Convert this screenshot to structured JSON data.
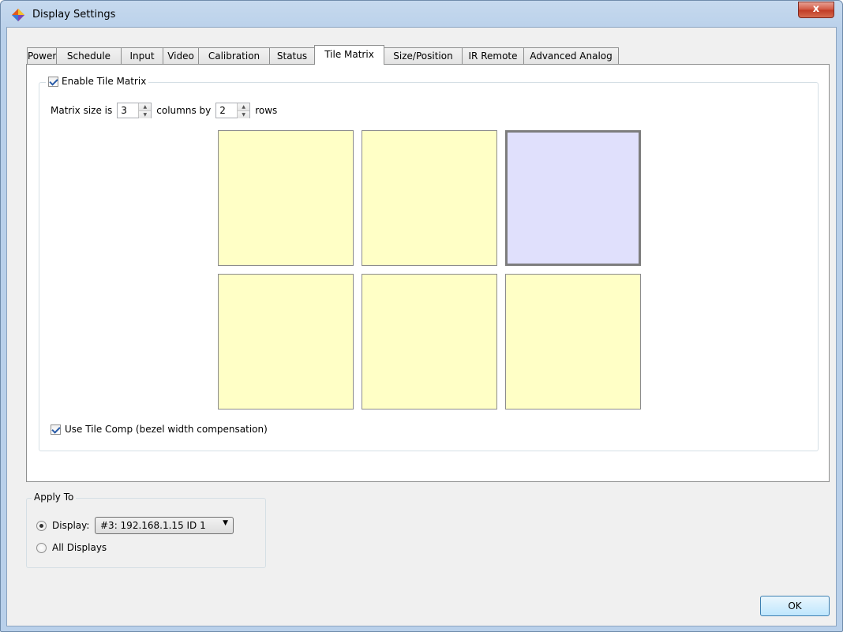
{
  "window": {
    "title": "Display Settings",
    "close_label": "x"
  },
  "tabs": [
    {
      "label": "Power",
      "active": false
    },
    {
      "label": "Schedule",
      "active": false
    },
    {
      "label": "Input",
      "active": false
    },
    {
      "label": "Video",
      "active": false
    },
    {
      "label": "Calibration",
      "active": false
    },
    {
      "label": "Status",
      "active": false
    },
    {
      "label": "Tile Matrix",
      "active": true
    },
    {
      "label": "Size/Position",
      "active": false
    },
    {
      "label": "IR Remote",
      "active": false
    },
    {
      "label": "Advanced Analog",
      "active": false
    }
  ],
  "tile_matrix": {
    "enable_label": "Enable Tile Matrix",
    "enable_checked": true,
    "matrix_prefix": "Matrix size is",
    "columns_value": "3",
    "columns_label": "columns by",
    "rows_value": "2",
    "rows_label": "rows",
    "tile_comp_label": "Use Tile Comp (bezel width compensation)",
    "tile_comp_checked": true,
    "selected_tile": "row 1, column 3",
    "tile_color": "#ffffc6",
    "selected_tile_color": "#e0e0fc"
  },
  "apply_to": {
    "legend": "Apply To",
    "display_label": "Display:",
    "display_selected": "#3: 192.168.1.15 ID 1",
    "all_displays_label": "All Displays"
  },
  "buttons": {
    "ok": "OK"
  }
}
